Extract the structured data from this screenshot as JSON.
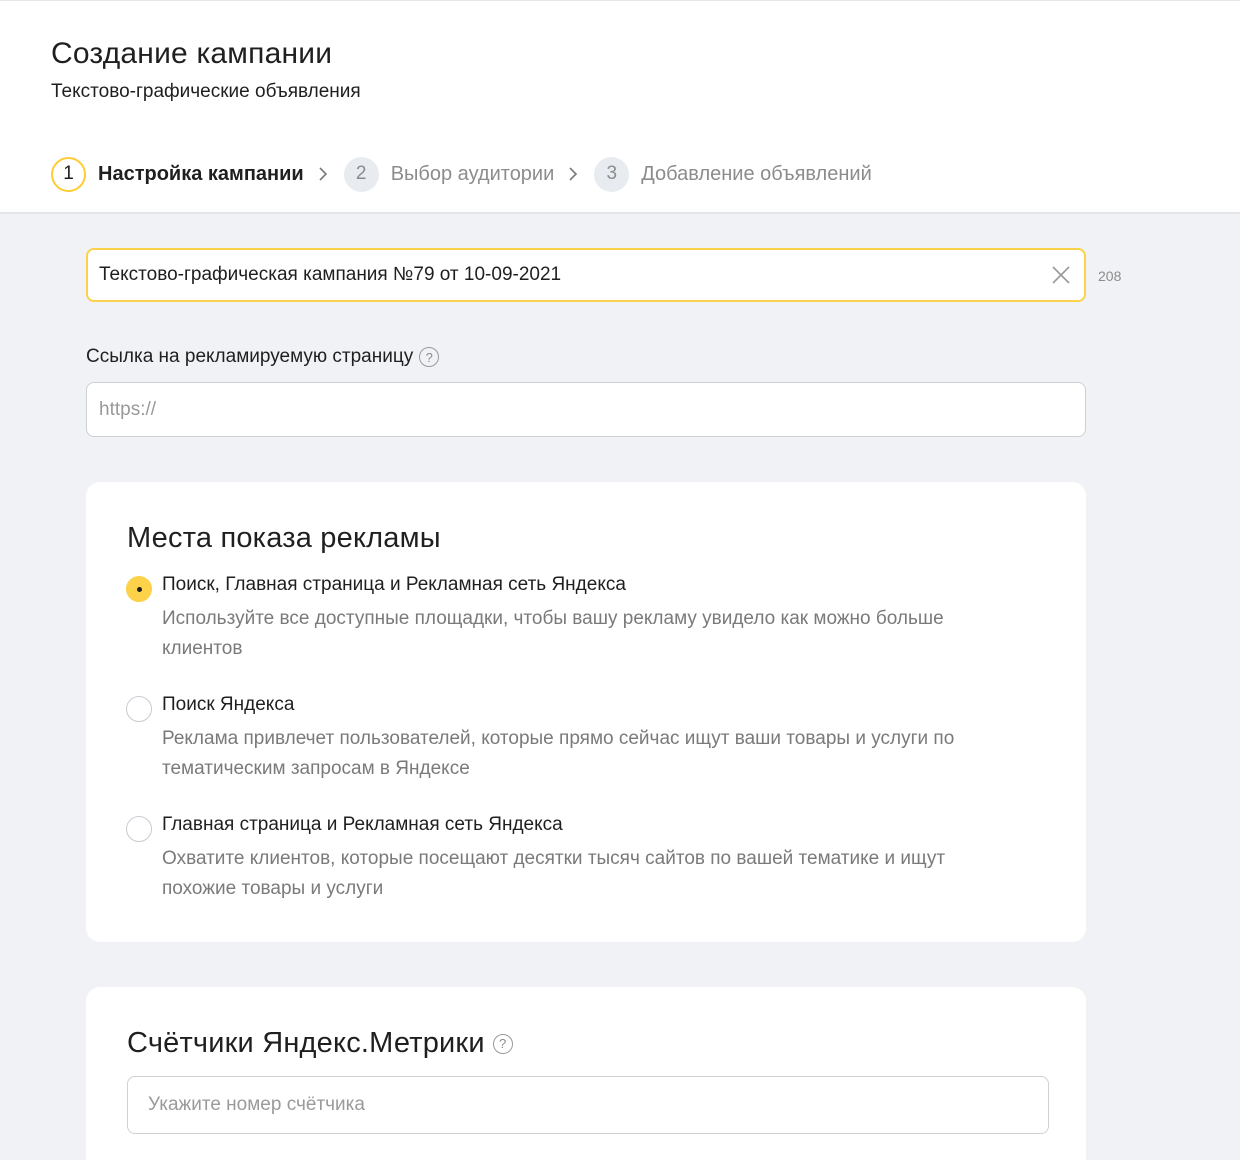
{
  "header": {
    "title": "Создание кампании",
    "subtitle": "Текстово-графические объявления"
  },
  "steps": [
    {
      "number": "1",
      "label": "Настройка кампании",
      "state": "active"
    },
    {
      "number": "2",
      "label": "Выбор аудитории",
      "state": "idle"
    },
    {
      "number": "3",
      "label": "Добавление объявлений",
      "state": "idle"
    }
  ],
  "campaign_name": {
    "value": "Текстово-графическая кампания №79 от 10-09-2021",
    "counter": "208"
  },
  "url_field": {
    "label": "Ссылка на рекламируемую страницу",
    "placeholder": "https://"
  },
  "placements": {
    "title": "Места показа рекламы",
    "options": [
      {
        "title": "Поиск, Главная страница и Рекламная сеть Яндекса",
        "description": "Используйте все доступные площадки, чтобы вашу рекламу увидело как можно больше клиентов",
        "selected": true
      },
      {
        "title": "Поиск Яндекса",
        "description": "Реклама привлечет пользователей, которые прямо сейчас ищут ваши товары и услуги по тематическим запросам в Яндексе",
        "selected": false
      },
      {
        "title": "Главная страница и Рекламная сеть Яндекса",
        "description": "Охватите клиентов, которые посещают десятки тысяч сайтов по вашей тематике и ищут похожие товары и услуги",
        "selected": false
      }
    ]
  },
  "metrika": {
    "title": "Счётчики Яндекс.Метрики",
    "placeholder": "Укажите номер счётчика"
  },
  "icons": {
    "help": "question-circle-icon",
    "clear": "close-icon",
    "step_separator": "chevron-right-icon"
  },
  "colors": {
    "accent": "#fcd24a",
    "background": "#f0f2f5",
    "muted_text": "#7a7a7a"
  }
}
